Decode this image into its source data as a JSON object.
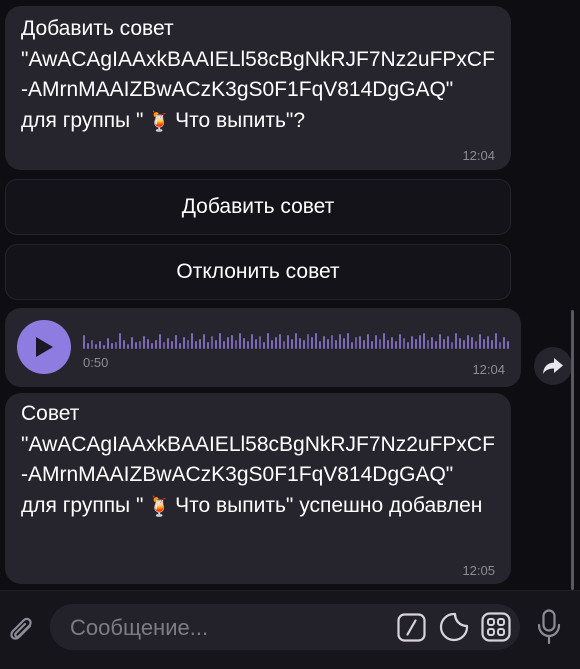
{
  "messages": [
    {
      "text": "Добавить совет\n\"AwACAgIAAxkBAAIELl58cBgNkRJF7Nz2uFPxCF-AMrnMAAIZBwACzK3gS0F1FqV814DgGAQ\"\nдля группы \"",
      "emoji": "🍹",
      "text_after": "Что выпить\"?",
      "time": "12:04"
    },
    {
      "type": "voice",
      "duration": "0:50",
      "time": "12:04"
    },
    {
      "text": "Совет\n\"AwACAgIAAxkBAAIELl58cBgNkRJF7Nz2uFPxCF-AMrnMAAIZBwACzK3gS0F1FqV814DgGAQ\"\nдля группы \"",
      "emoji": "🍹",
      "text_after": "Что выпить\" успешно добавлен",
      "time": "12:05"
    }
  ],
  "keyboard": {
    "add_label": "Добавить совет",
    "reject_label": "Отклонить совет"
  },
  "composer": {
    "placeholder": "Сообщение..."
  },
  "icons": {
    "play": "play-icon",
    "forward": "forward-share-icon",
    "attach": "paperclip-icon",
    "commands": "slash-command-icon",
    "sticker": "sticker-icon",
    "emoji_menu": "emoji-grid-icon",
    "mic": "microphone-icon"
  },
  "colors": {
    "accent": "#8e7ce0",
    "bubble": "#26242d",
    "background": "#0e0d12"
  }
}
